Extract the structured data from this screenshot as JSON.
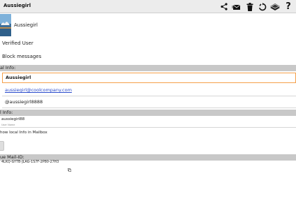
{
  "toolbar": {
    "title": "Aussiegirl",
    "icons": [
      "share-icon",
      "compose-mail-icon",
      "trash-icon",
      "refresh-icon",
      "books-icon",
      "help-icon"
    ],
    "help_glyph": "?"
  },
  "profile": {
    "name": "Aussiegirl"
  },
  "rows": {
    "verified": "Verified User",
    "block": "Block messages"
  },
  "local_info": {
    "header": "al Info:",
    "name_value": "Aussiegirl",
    "email_value": "aussiegirl@coolcompany.com",
    "handle_value": "@aussiegirl8888"
  },
  "global_info": {
    "header": "l Info:",
    "username": "aussiegirl88",
    "username_caption": "User Name",
    "show_local": "how local Info in Mailbox"
  },
  "mail_id": {
    "header": "ue Mail-ID:",
    "value": "4LKQ-GYTB-JLAG-1S7F-2P80-27H3"
  },
  "colors": {
    "accent": "#f5a04a",
    "link": "#2b4ccc",
    "header_bg": "#c8c8c8",
    "toolbar_bg": "#ececec"
  }
}
